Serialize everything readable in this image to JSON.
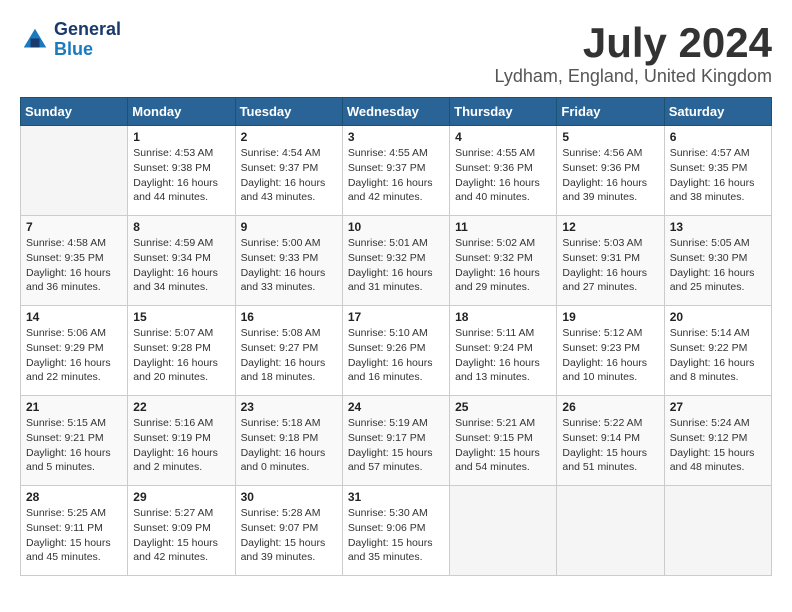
{
  "logo": {
    "line1": "General",
    "line2": "Blue"
  },
  "title": "July 2024",
  "location": "Lydham, England, United Kingdom",
  "days_of_week": [
    "Sunday",
    "Monday",
    "Tuesday",
    "Wednesday",
    "Thursday",
    "Friday",
    "Saturday"
  ],
  "weeks": [
    [
      {
        "day": "",
        "sunrise": "",
        "sunset": "",
        "daylight": ""
      },
      {
        "day": "1",
        "sunrise": "Sunrise: 4:53 AM",
        "sunset": "Sunset: 9:38 PM",
        "daylight": "Daylight: 16 hours and 44 minutes."
      },
      {
        "day": "2",
        "sunrise": "Sunrise: 4:54 AM",
        "sunset": "Sunset: 9:37 PM",
        "daylight": "Daylight: 16 hours and 43 minutes."
      },
      {
        "day": "3",
        "sunrise": "Sunrise: 4:55 AM",
        "sunset": "Sunset: 9:37 PM",
        "daylight": "Daylight: 16 hours and 42 minutes."
      },
      {
        "day": "4",
        "sunrise": "Sunrise: 4:55 AM",
        "sunset": "Sunset: 9:36 PM",
        "daylight": "Daylight: 16 hours and 40 minutes."
      },
      {
        "day": "5",
        "sunrise": "Sunrise: 4:56 AM",
        "sunset": "Sunset: 9:36 PM",
        "daylight": "Daylight: 16 hours and 39 minutes."
      },
      {
        "day": "6",
        "sunrise": "Sunrise: 4:57 AM",
        "sunset": "Sunset: 9:35 PM",
        "daylight": "Daylight: 16 hours and 38 minutes."
      }
    ],
    [
      {
        "day": "7",
        "sunrise": "Sunrise: 4:58 AM",
        "sunset": "Sunset: 9:35 PM",
        "daylight": "Daylight: 16 hours and 36 minutes."
      },
      {
        "day": "8",
        "sunrise": "Sunrise: 4:59 AM",
        "sunset": "Sunset: 9:34 PM",
        "daylight": "Daylight: 16 hours and 34 minutes."
      },
      {
        "day": "9",
        "sunrise": "Sunrise: 5:00 AM",
        "sunset": "Sunset: 9:33 PM",
        "daylight": "Daylight: 16 hours and 33 minutes."
      },
      {
        "day": "10",
        "sunrise": "Sunrise: 5:01 AM",
        "sunset": "Sunset: 9:32 PM",
        "daylight": "Daylight: 16 hours and 31 minutes."
      },
      {
        "day": "11",
        "sunrise": "Sunrise: 5:02 AM",
        "sunset": "Sunset: 9:32 PM",
        "daylight": "Daylight: 16 hours and 29 minutes."
      },
      {
        "day": "12",
        "sunrise": "Sunrise: 5:03 AM",
        "sunset": "Sunset: 9:31 PM",
        "daylight": "Daylight: 16 hours and 27 minutes."
      },
      {
        "day": "13",
        "sunrise": "Sunrise: 5:05 AM",
        "sunset": "Sunset: 9:30 PM",
        "daylight": "Daylight: 16 hours and 25 minutes."
      }
    ],
    [
      {
        "day": "14",
        "sunrise": "Sunrise: 5:06 AM",
        "sunset": "Sunset: 9:29 PM",
        "daylight": "Daylight: 16 hours and 22 minutes."
      },
      {
        "day": "15",
        "sunrise": "Sunrise: 5:07 AM",
        "sunset": "Sunset: 9:28 PM",
        "daylight": "Daylight: 16 hours and 20 minutes."
      },
      {
        "day": "16",
        "sunrise": "Sunrise: 5:08 AM",
        "sunset": "Sunset: 9:27 PM",
        "daylight": "Daylight: 16 hours and 18 minutes."
      },
      {
        "day": "17",
        "sunrise": "Sunrise: 5:10 AM",
        "sunset": "Sunset: 9:26 PM",
        "daylight": "Daylight: 16 hours and 16 minutes."
      },
      {
        "day": "18",
        "sunrise": "Sunrise: 5:11 AM",
        "sunset": "Sunset: 9:24 PM",
        "daylight": "Daylight: 16 hours and 13 minutes."
      },
      {
        "day": "19",
        "sunrise": "Sunrise: 5:12 AM",
        "sunset": "Sunset: 9:23 PM",
        "daylight": "Daylight: 16 hours and 10 minutes."
      },
      {
        "day": "20",
        "sunrise": "Sunrise: 5:14 AM",
        "sunset": "Sunset: 9:22 PM",
        "daylight": "Daylight: 16 hours and 8 minutes."
      }
    ],
    [
      {
        "day": "21",
        "sunrise": "Sunrise: 5:15 AM",
        "sunset": "Sunset: 9:21 PM",
        "daylight": "Daylight: 16 hours and 5 minutes."
      },
      {
        "day": "22",
        "sunrise": "Sunrise: 5:16 AM",
        "sunset": "Sunset: 9:19 PM",
        "daylight": "Daylight: 16 hours and 2 minutes."
      },
      {
        "day": "23",
        "sunrise": "Sunrise: 5:18 AM",
        "sunset": "Sunset: 9:18 PM",
        "daylight": "Daylight: 16 hours and 0 minutes."
      },
      {
        "day": "24",
        "sunrise": "Sunrise: 5:19 AM",
        "sunset": "Sunset: 9:17 PM",
        "daylight": "Daylight: 15 hours and 57 minutes."
      },
      {
        "day": "25",
        "sunrise": "Sunrise: 5:21 AM",
        "sunset": "Sunset: 9:15 PM",
        "daylight": "Daylight: 15 hours and 54 minutes."
      },
      {
        "day": "26",
        "sunrise": "Sunrise: 5:22 AM",
        "sunset": "Sunset: 9:14 PM",
        "daylight": "Daylight: 15 hours and 51 minutes."
      },
      {
        "day": "27",
        "sunrise": "Sunrise: 5:24 AM",
        "sunset": "Sunset: 9:12 PM",
        "daylight": "Daylight: 15 hours and 48 minutes."
      }
    ],
    [
      {
        "day": "28",
        "sunrise": "Sunrise: 5:25 AM",
        "sunset": "Sunset: 9:11 PM",
        "daylight": "Daylight: 15 hours and 45 minutes."
      },
      {
        "day": "29",
        "sunrise": "Sunrise: 5:27 AM",
        "sunset": "Sunset: 9:09 PM",
        "daylight": "Daylight: 15 hours and 42 minutes."
      },
      {
        "day": "30",
        "sunrise": "Sunrise: 5:28 AM",
        "sunset": "Sunset: 9:07 PM",
        "daylight": "Daylight: 15 hours and 39 minutes."
      },
      {
        "day": "31",
        "sunrise": "Sunrise: 5:30 AM",
        "sunset": "Sunset: 9:06 PM",
        "daylight": "Daylight: 15 hours and 35 minutes."
      },
      {
        "day": "",
        "sunrise": "",
        "sunset": "",
        "daylight": ""
      },
      {
        "day": "",
        "sunrise": "",
        "sunset": "",
        "daylight": ""
      },
      {
        "day": "",
        "sunrise": "",
        "sunset": "",
        "daylight": ""
      }
    ]
  ]
}
